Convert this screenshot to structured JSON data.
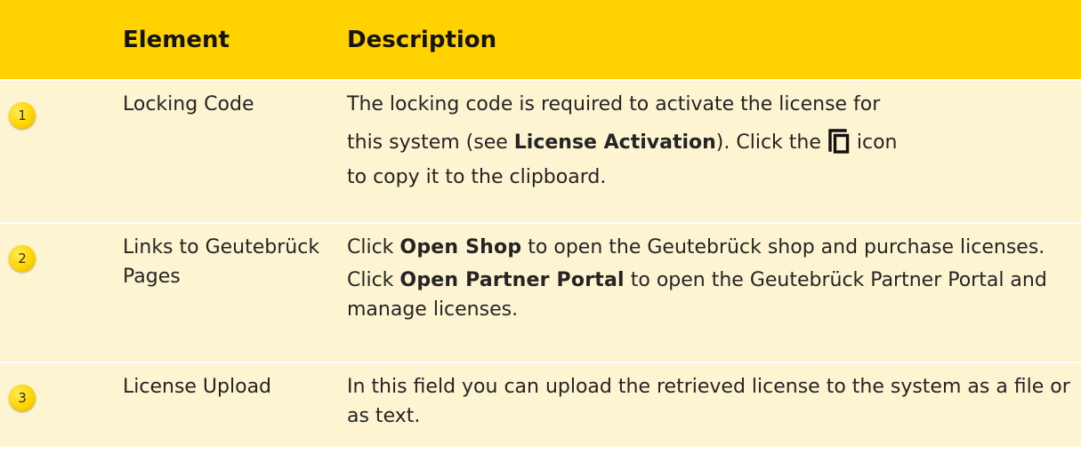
{
  "colors": {
    "header_bg": "#ffd200",
    "row_bg": "#fdf5d2",
    "callout": "#ffd500"
  },
  "header": {
    "number_col": "",
    "element_col": "Element",
    "description_col": "Description"
  },
  "rows": [
    {
      "number": "1",
      "element": "Locking Code",
      "description": {
        "line1": "The locking code is required to activate the license for",
        "line2_pre": "this system (see ",
        "line2_bold": "License Activation",
        "line2_mid": "). Click the",
        "icon": "copy-icon",
        "line2_post": "icon",
        "line3": "to copy it to the clipboard."
      }
    },
    {
      "number": "2",
      "element": "Links to Geutebrück Pages",
      "description": {
        "p1_pre": "Click ",
        "p1_bold": "Open Shop",
        "p1_post": " to open the Geutebrück shop and purchase licenses.",
        "p2_pre": "Click ",
        "p2_bold": "Open Partner Portal",
        "p2_post": " to open the Geutebrück Partner Portal and manage licenses."
      }
    },
    {
      "number": "3",
      "element": "License Upload",
      "description": {
        "text": "In this field you can upload the retrieved license to the system as a file or as text."
      }
    }
  ]
}
